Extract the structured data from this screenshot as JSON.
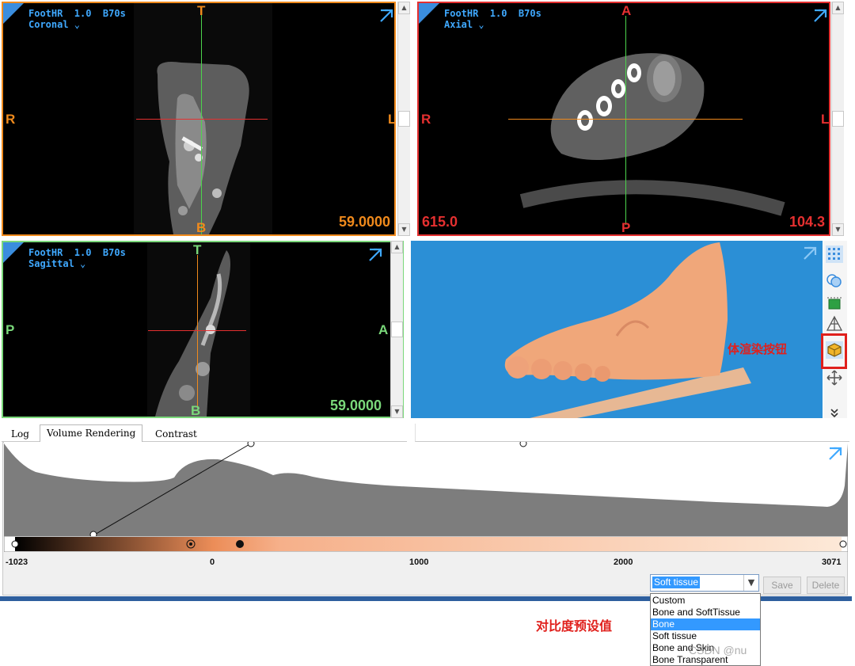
{
  "viewports": {
    "coronal": {
      "protocol": "FootHR  1.0  B70s",
      "plane": "Coronal",
      "orient_top": "T",
      "orient_bottom": "B",
      "orient_left": "R",
      "orient_right": "L",
      "readout": "59.0000",
      "border_color": "#f08a1c"
    },
    "axial": {
      "protocol": "FootHR  1.0  B70s",
      "plane": "Axial",
      "orient_top": "A",
      "orient_bottom": "P",
      "orient_left": "R",
      "orient_right": "L",
      "readout_left": "615.0",
      "readout_right": "104.3",
      "border_color": "#e53030"
    },
    "sagittal": {
      "protocol": "FootHR  1.0  B70s",
      "plane": "Sagittal",
      "orient_top": "T",
      "orient_bottom": "B",
      "orient_left": "P",
      "orient_right": "A",
      "readout": "59.0000",
      "border_color": "#7ad87a"
    },
    "volume_3d": {
      "background_color": "#2b8fd6"
    }
  },
  "side_toolbar": {
    "icons": [
      "grid-layout-icon",
      "overlay-icon",
      "crop-box-icon",
      "mesh-icon",
      "volume-render-icon",
      "move-icon",
      "more-chevron-icon"
    ]
  },
  "annotations": {
    "volume_button_note": "体渲染按钮",
    "preset_note": "对比度预设值",
    "accent_color": "#e0201c"
  },
  "tabs": [
    {
      "label": "Log",
      "active": false
    },
    {
      "label": "Volume Rendering",
      "active": true
    },
    {
      "label": "Contrast",
      "active": false
    }
  ],
  "transfer_function": {
    "axis_ticks": [
      "-1023",
      "0",
      "1000",
      "2000",
      "3071"
    ],
    "range": [
      -1023,
      3071
    ]
  },
  "preset": {
    "selected": "Soft tissue",
    "options": [
      "Custom",
      "Bone and SoftTissue",
      "Bone",
      "Soft tissue",
      "Bone and Skin",
      "Bone Transparent"
    ],
    "highlighted": "Bone",
    "save_label": "Save",
    "delete_label": "Delete"
  },
  "watermark": "CSDN @nu"
}
